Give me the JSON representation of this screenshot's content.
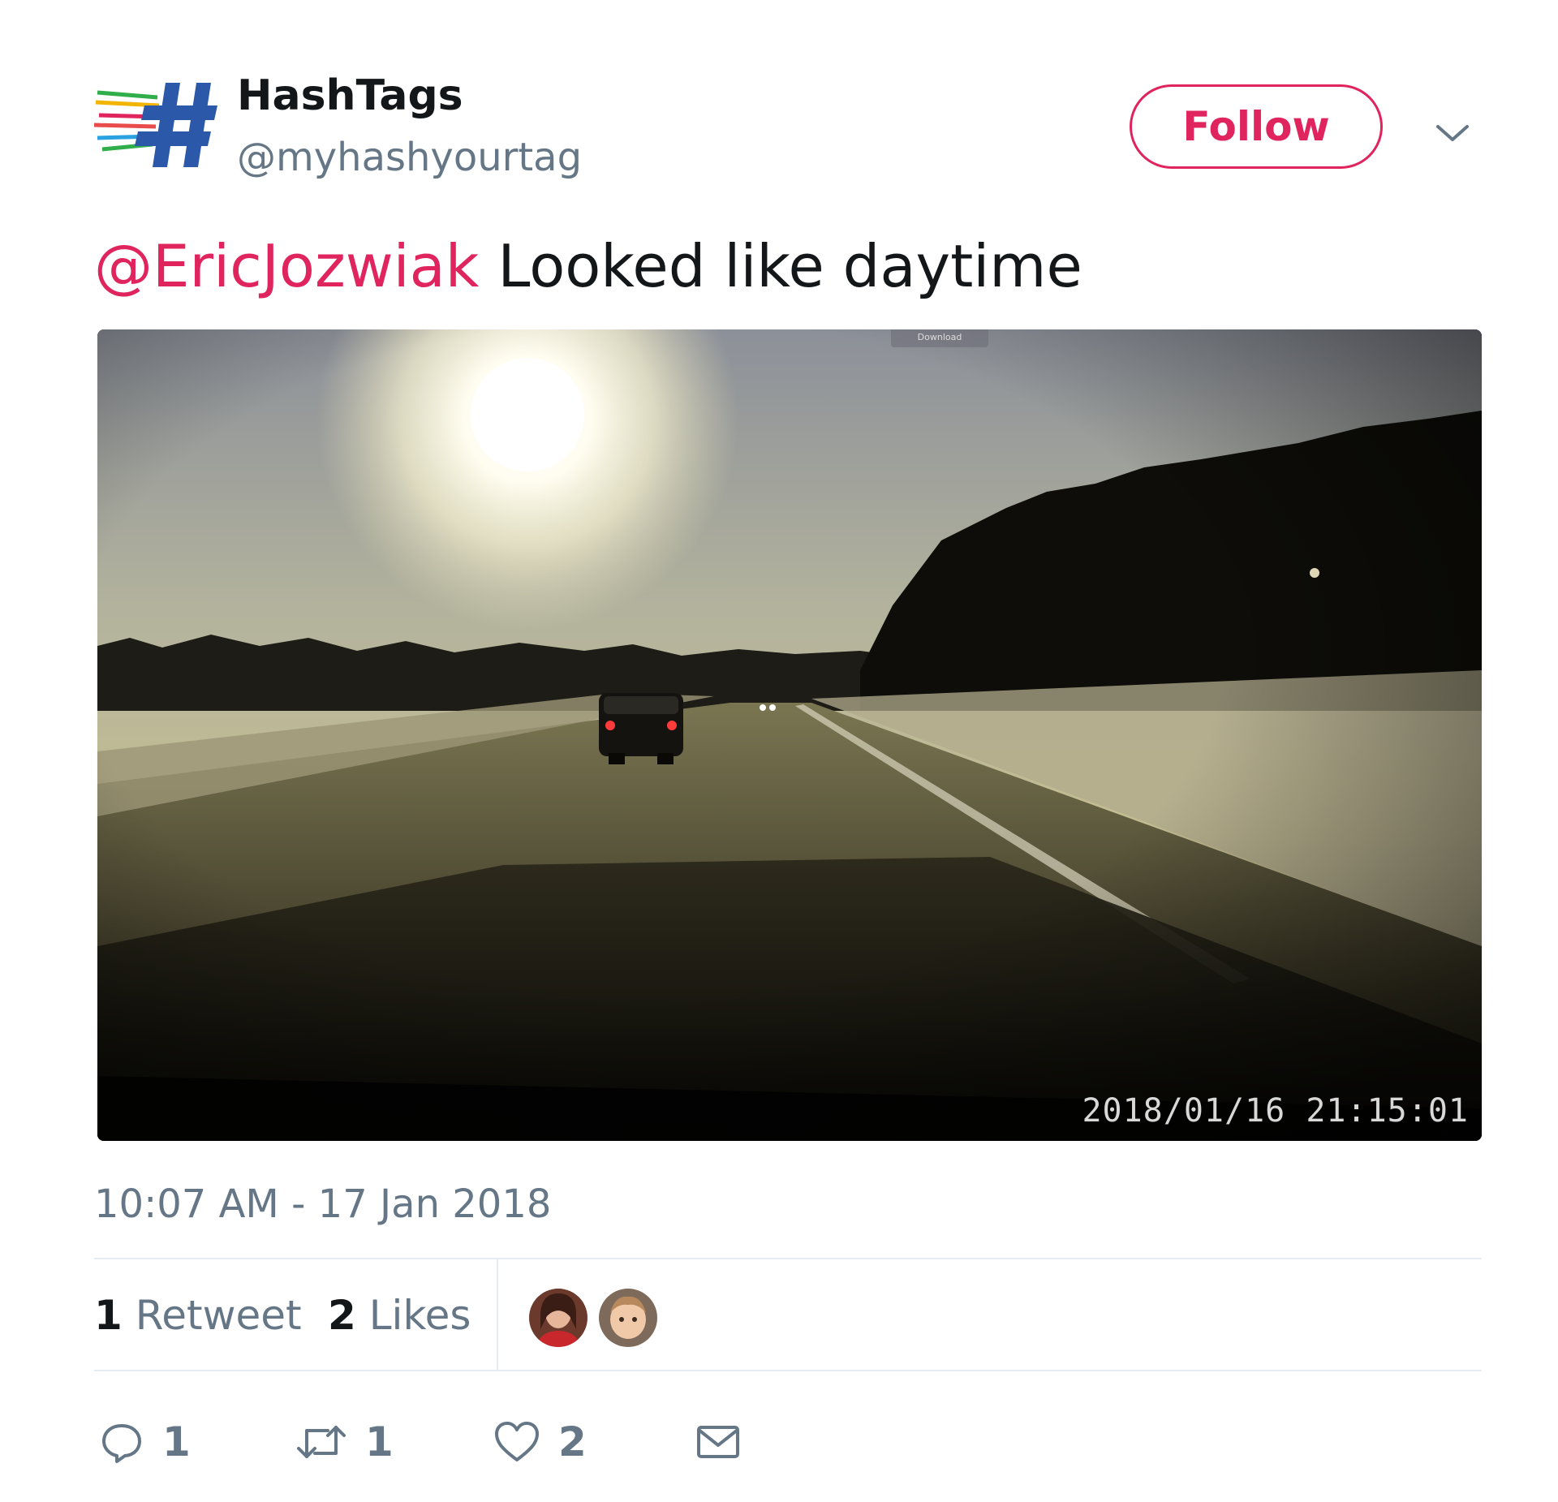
{
  "user": {
    "display_name": "HashTags",
    "handle": "@myhashyourtag",
    "avatar_icon": "hashtag-logo-icon"
  },
  "header": {
    "follow_label": "Follow",
    "menu_icon": "chevron-down-icon"
  },
  "tweet": {
    "mention": "@EricJozwiak",
    "text": " Looked like daytime",
    "timestamp": "10:07 AM - 17 Jan 2018"
  },
  "media": {
    "overlay_timestamp": "2018/01/16 21:15:01",
    "download_tab_label": "Download"
  },
  "stats": {
    "retweets_count": "1",
    "retweets_label": "Retweet",
    "likes_count": "2",
    "likes_label": "Likes"
  },
  "actions": {
    "reply_count": "1",
    "retweet_count": "1",
    "like_count": "2",
    "reply_icon": "reply-icon",
    "retweet_icon": "retweet-icon",
    "like_icon": "heart-icon",
    "dm_icon": "envelope-icon"
  },
  "colors": {
    "accent": "#e0245e",
    "muted": "#657786",
    "text": "#14171a",
    "divider": "#e6ecf0"
  }
}
